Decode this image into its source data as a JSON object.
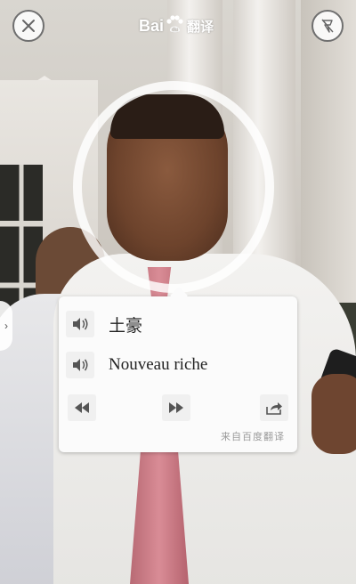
{
  "header": {
    "logo_text": "Bai",
    "logo_suffix": "翻译",
    "close_icon": "close-icon",
    "flash_icon": "flash-off-icon"
  },
  "side_tab": {
    "icon": "chevron-right-icon",
    "glyph": "›"
  },
  "translation_card": {
    "source_text": "土豪",
    "translated_text": "Nouveau riche",
    "speaker_icon": "speaker-icon",
    "prev_icon": "rewind-icon",
    "next_icon": "fast-forward-icon",
    "share_icon": "share-icon",
    "attribution": "来自百度翻译"
  },
  "colors": {
    "card_bg": "#fbfbfb",
    "button_bg": "#f0f0f0",
    "icon_gray": "#555555",
    "attribution_gray": "#9a9a9a",
    "ring": "#ffffff"
  }
}
